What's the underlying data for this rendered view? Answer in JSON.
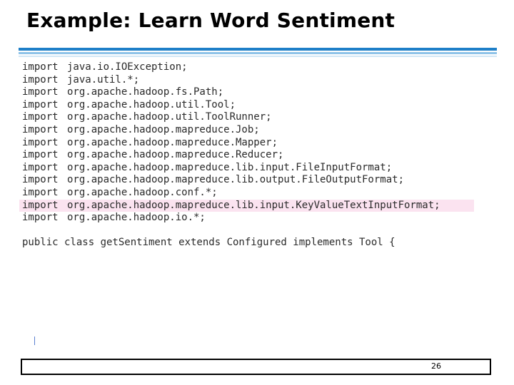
{
  "slide": {
    "title": "Example: Learn Word Sentiment",
    "page_number": "26"
  },
  "code": {
    "imports": [
      {
        "keyword": "import",
        "target": "java.io.IOException;"
      },
      {
        "keyword": "import",
        "target": "java.util.*;"
      },
      {
        "keyword": "import",
        "target": "org.apache.hadoop.fs.Path;"
      },
      {
        "keyword": "import",
        "target": "org.apache.hadoop.util.Tool;"
      },
      {
        "keyword": "import",
        "target": "org.apache.hadoop.util.ToolRunner;"
      },
      {
        "keyword": "import",
        "target": "org.apache.hadoop.mapreduce.Job;"
      },
      {
        "keyword": "import",
        "target": "org.apache.hadoop.mapreduce.Mapper;"
      },
      {
        "keyword": "import",
        "target": "org.apache.hadoop.mapreduce.Reducer;"
      },
      {
        "keyword": "import",
        "target": "org.apache.hadoop.mapreduce.lib.input.FileInputFormat;"
      },
      {
        "keyword": "import",
        "target": "org.apache.hadoop.mapreduce.lib.output.FileOutputFormat;"
      },
      {
        "keyword": "import",
        "target": "org.apache.hadoop.conf.*;"
      },
      {
        "keyword": "import",
        "target": "org.apache.hadoop.mapreduce.lib.input.KeyValueTextInputFormat;"
      },
      {
        "keyword": "import",
        "target": "org.apache.hadoop.io.*;"
      }
    ],
    "class_declaration": "public class getSentiment extends Configured implements Tool {"
  },
  "colors": {
    "accent_rule": "#1e7fc8",
    "highlight": "#fbe3f0"
  }
}
